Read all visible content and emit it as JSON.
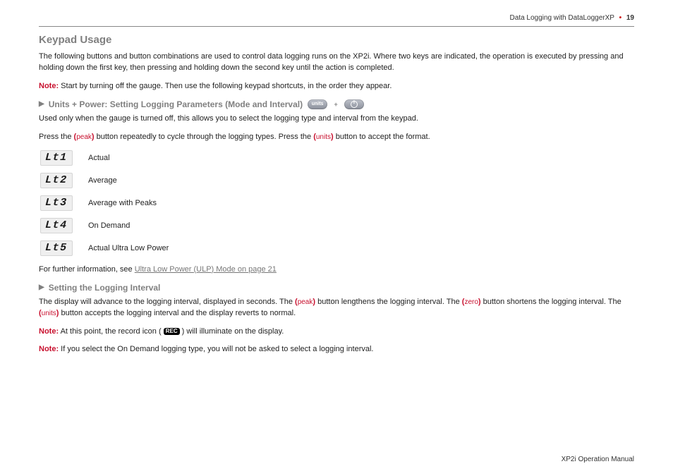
{
  "header": {
    "running_title": "Data Logging with DataLoggerXP",
    "page_num": "19"
  },
  "title": "Keypad Usage",
  "intro": "The following buttons and button combinations are used to control data logging runs on the XP2i. Where two keys are indicated, the operation is executed by pressing and holding down the first key, then pressing and holding down the second key until the action is completed.",
  "note_label": "Note:",
  "note1_body": "Start by turning off the gauge. Then use the following keypad shortcuts, in the order they appear.",
  "sub1": {
    "title": "Units + Power: Setting Logging Parameters (Mode and Interval)",
    "key1": "units",
    "desc": "Used only when the gauge is turned off, this allows you to select the logging type and interval from the keypad.",
    "press_a": "Press the ",
    "peak": "peak",
    "press_b": " button repeatedly to cycle through the logging types. Press the ",
    "units": "units",
    "press_c": " button to accept the format."
  },
  "lcd": [
    {
      "code": "Lt1",
      "label": "Actual"
    },
    {
      "code": "Lt2",
      "label": "Average"
    },
    {
      "code": "Lt3",
      "label": "Average with Peaks"
    },
    {
      "code": "Lt4",
      "label": "On Demand"
    },
    {
      "code": "Lt5",
      "label": "Actual Ultra Low Power"
    }
  ],
  "further_a": "For further information, see ",
  "further_link": "Ultra Low Power (ULP) Mode on page 21",
  "sub2": {
    "title": "Setting the Logging Interval",
    "body_a": "The display will advance to the logging interval, displayed in seconds. The ",
    "peak": "peak",
    "body_b": " button lengthens the logging interval. The ",
    "zero": "zero",
    "body_c": " button shortens the logging interval. The ",
    "units": "units",
    "body_d": " button accepts the logging interval and the display reverts to normal."
  },
  "note2_a": "At this point, the record icon ( ",
  "rec": "REC",
  "note2_b": " ) will illuminate on the display.",
  "note3": "If you select the On Demand logging type, you will not be asked to select a logging interval.",
  "footer": "XP2i Operation Manual"
}
